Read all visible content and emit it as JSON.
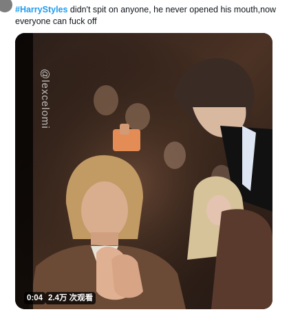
{
  "tweet": {
    "hashtag": "#HarryStyles",
    "text": " didn't spit on anyone, he never opened his mouth,now everyone can fuck off"
  },
  "video": {
    "watermark": "@lexcelomi",
    "elapsed": "0:04",
    "views": "2.4万 次观看"
  },
  "colors": {
    "hashtag": "#1d9bf0",
    "text": "#0f1419",
    "overlay": "#000000"
  }
}
